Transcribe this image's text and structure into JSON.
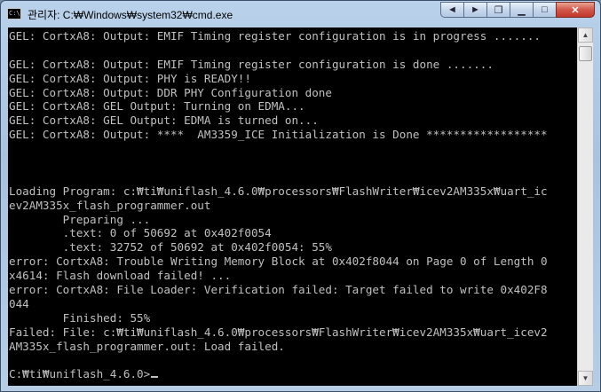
{
  "window": {
    "title": "관리자: C:₩Windows₩system32₩cmd.exe",
    "app_icon_text": "C:\\"
  },
  "controls": {
    "icons": [
      "arrow-left-icon",
      "arrow-right-icon",
      "restore-icon",
      "minimize-icon",
      "maximize-icon",
      "close-icon"
    ]
  },
  "console": {
    "lines": [
      "GEL: CortxA8: Output: EMIF Timing register configuration is in progress .......",
      "",
      "GEL: CortxA8: Output: EMIF Timing register configuration is done .......",
      "GEL: CortxA8: Output: PHY is READY!!",
      "GEL: CortxA8: Output: DDR PHY Configuration done",
      "GEL: CortxA8: GEL Output: Turning on EDMA...",
      "GEL: CortxA8: GEL Output: EDMA is turned on...",
      "GEL: CortxA8: Output: ****  AM3359_ICE Initialization is Done ******************",
      "",
      "",
      "",
      "Loading Program: c:₩ti₩uniflash_4.6.0₩processors₩FlashWriter₩icev2AM335x₩uart_ic",
      "ev2AM335x_flash_programmer.out",
      "        Preparing ...",
      "        .text: 0 of 50692 at 0x402f0054",
      "        .text: 32752 of 50692 at 0x402f0054: 55%",
      "error: CortxA8: Trouble Writing Memory Block at 0x402f8044 on Page 0 of Length 0",
      "x4614: Flash download failed! ...",
      "error: CortxA8: File Loader: Verification failed: Target failed to write 0x402F8",
      "044",
      "        Finished: 55%",
      "Failed: File: c:₩ti₩uniflash_4.6.0₩processors₩FlashWriter₩icev2AM335x₩uart_icev2",
      "AM335x_flash_programmer.out: Load failed.",
      ""
    ],
    "prompt": "C:₩ti₩uniflash_4.6.0>"
  }
}
